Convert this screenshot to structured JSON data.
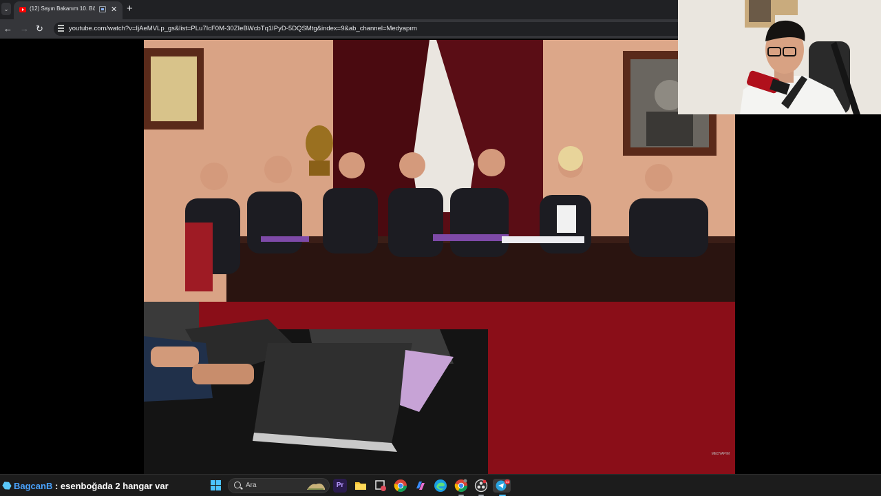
{
  "browser": {
    "tab": {
      "title": "(12) Sayın Bakanım 10. Bölü",
      "close": "✕"
    },
    "new_tab": "+",
    "tab_menu": "⌄",
    "nav": {
      "back": "←",
      "forward": "→",
      "reload": "↻"
    },
    "url": "youtube.com/watch?v=IjAeMVLp_gs&list=PLu7IcF0M-30ZIeBWcbTq1IPyD-5DQSMtg&index=9&ab_channel=Medyapım"
  },
  "video": {
    "watermark": "MEDYAPIM"
  },
  "taskbar": {
    "chat_user": "BagcanB",
    "chat_message": " : esenboğada 2 hangar var",
    "search_label": "Ara",
    "premiere_label": "Pr",
    "badge_count": "34"
  },
  "colors": {
    "chat_user": "#4aa3ff",
    "windows_accent": "#4cc2ff",
    "youtube_red": "#ff0000"
  }
}
